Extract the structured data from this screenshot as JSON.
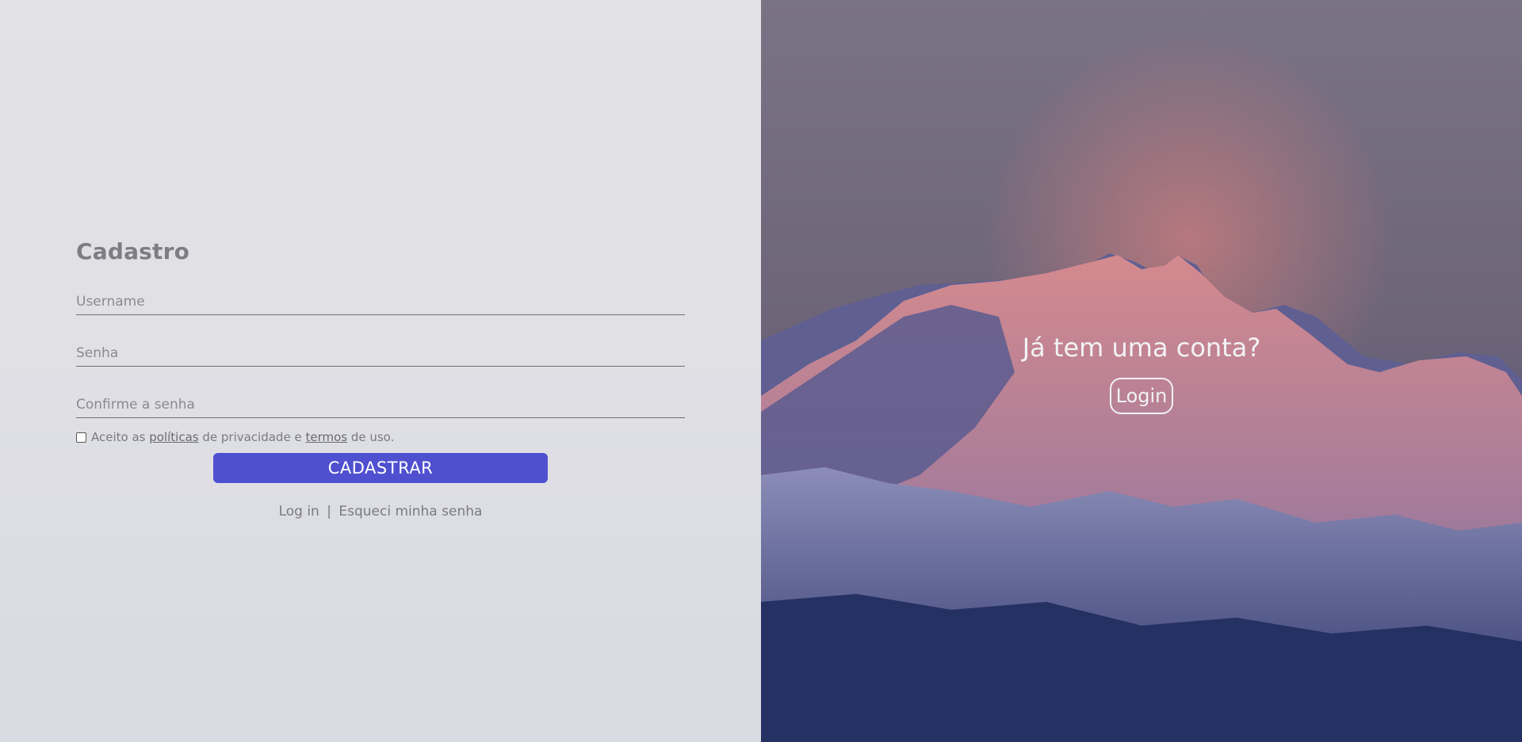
{
  "signup": {
    "title": "Cadastro",
    "username_placeholder": "Username",
    "password_placeholder": "Senha",
    "confirm_placeholder": "Confirme a senha",
    "terms": {
      "prefix": "Aceito as ",
      "policies_link": "políticas",
      "middle": " de privacidade e ",
      "terms_link": "termos",
      "suffix": " de uso."
    },
    "submit_label": "CADASTRAR",
    "login_link": "Log in",
    "separator": "|",
    "forgot_link": "Esqueci minha senha"
  },
  "aside": {
    "title": "Já tem uma conta?",
    "login_button": "Login"
  },
  "colors": {
    "accent": "#4f50cf",
    "panel": "#f3f4f7",
    "text": "#7d7d84"
  }
}
